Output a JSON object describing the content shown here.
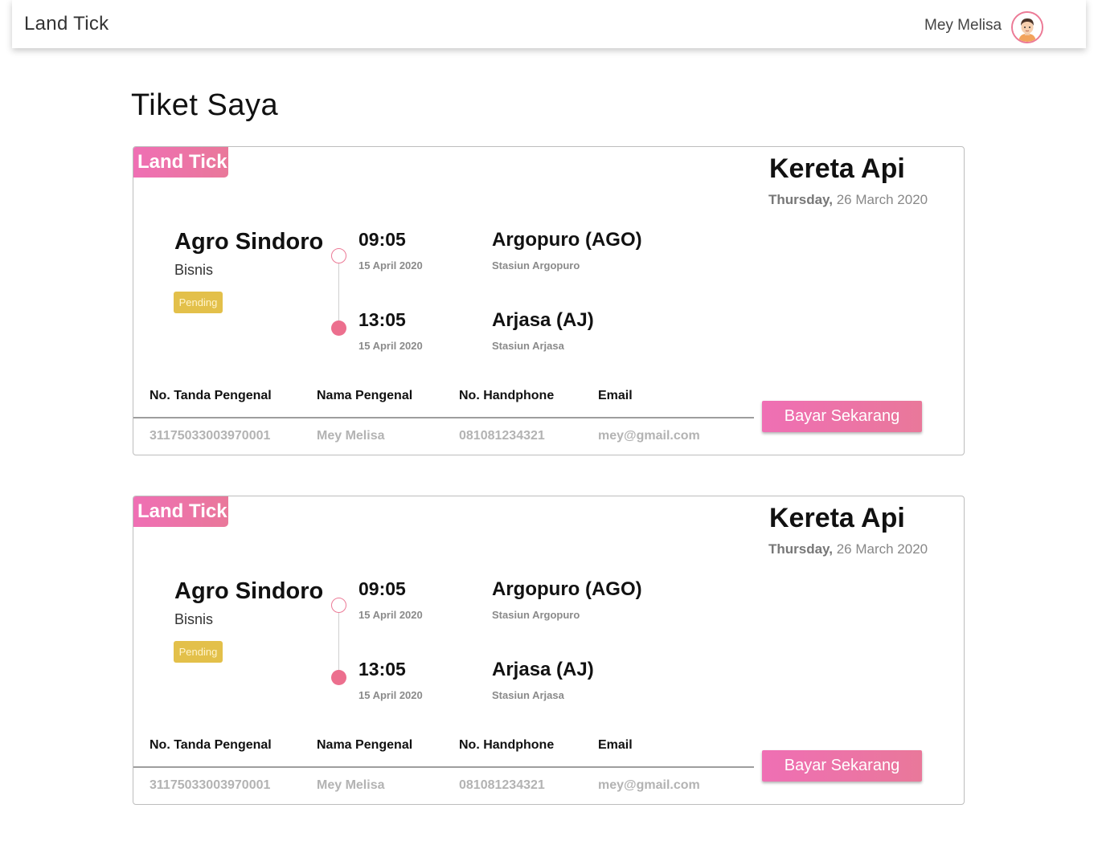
{
  "navbar": {
    "brand": "Land Tick",
    "user_name": "Mey Melisa",
    "avatar_icon": "user-avatar-icon"
  },
  "page_title": "Tiket Saya",
  "tickets": [
    {
      "logo": "Land Tick",
      "transport": "Kereta Api",
      "day": "Thursday,",
      "date": "26 March 2020",
      "train_name": "Agro Sindoro",
      "train_class": "Bisnis",
      "status": "Pending",
      "departure": {
        "time": "09:05",
        "date": "15 April 2020",
        "station": "Argopuro (AGO)",
        "station_sub": "Stasiun Argopuro"
      },
      "arrival": {
        "time": "13:05",
        "date": "15 April 2020",
        "station": "Arjasa (AJ)",
        "station_sub": "Stasiun Arjasa"
      },
      "table": {
        "headers": [
          "No. Tanda Pengenal",
          "Nama Pengenal",
          "No. Handphone",
          "Email"
        ],
        "row": [
          "31175033003970001",
          "Mey Melisa",
          "081081234321",
          "mey@gmail.com"
        ]
      },
      "pay_button": "Bayar Sekarang"
    },
    {
      "logo": "Land Tick",
      "transport": "Kereta Api",
      "day": "Thursday,",
      "date": "26 March 2020",
      "train_name": "Agro Sindoro",
      "train_class": "Bisnis",
      "status": "Pending",
      "departure": {
        "time": "09:05",
        "date": "15 April 2020",
        "station": "Argopuro (AGO)",
        "station_sub": "Stasiun Argopuro"
      },
      "arrival": {
        "time": "13:05",
        "date": "15 April 2020",
        "station": "Arjasa (AJ)",
        "station_sub": "Stasiun Arjasa"
      },
      "table": {
        "headers": [
          "No. Tanda Pengenal",
          "Nama Pengenal",
          "No. Handphone",
          "Email"
        ],
        "row": [
          "31175033003970001",
          "Mey Melisa",
          "081081234321",
          "mey@gmail.com"
        ]
      },
      "pay_button": "Bayar Sekarang"
    }
  ],
  "colors": {
    "accent_pink": "#ec7a96",
    "gradient_start": "#ef6fb4",
    "gradient_end": "#e9789a",
    "pending_yellow": "#e3c04a"
  }
}
